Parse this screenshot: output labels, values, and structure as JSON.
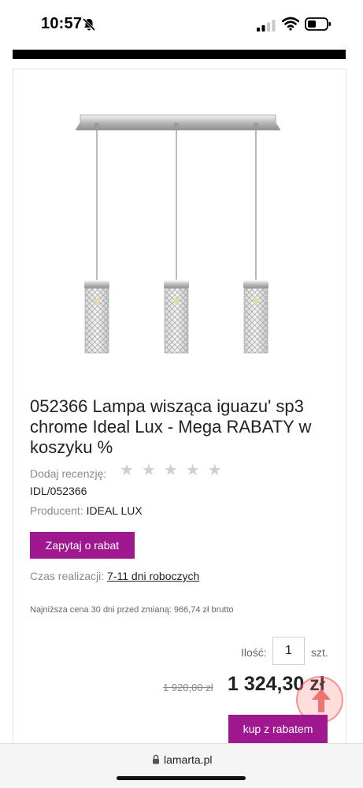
{
  "status_bar": {
    "time": "10:57",
    "icons": [
      "bell-slash-icon",
      "cellular-signal-icon",
      "wifi-icon",
      "battery-icon"
    ]
  },
  "product": {
    "title": "052366 Lampa wisząca iguazu' sp3 chrome Ideal Lux - Mega RABATY w koszyku %",
    "review_label": "Dodaj recenzję:",
    "rating_stars": 5,
    "rating_value": 0,
    "sku": "IDL/052366",
    "producer_label": "Producent:",
    "producer_value": "IDEAL LUX",
    "ask_button": "Zapytaj o rabat",
    "delivery_label": "Czas realizacji:",
    "delivery_value": "7-11 dni roboczych",
    "lowest_price_note": "Najniższa cena 30 dni przed zmianą: 966,74 zł brutto",
    "quantity_label": "Ilość:",
    "quantity_value": "1",
    "quantity_unit": "szt.",
    "old_price": "1 920,00 zł",
    "new_price": "1 324,30 zł",
    "buy_button": "kup z rabatem"
  },
  "browser": {
    "url": "lamarta.pl"
  },
  "colors": {
    "accent": "#a0188f",
    "star_empty": "#cfcfcf",
    "muted_text": "#8a8a8a"
  }
}
